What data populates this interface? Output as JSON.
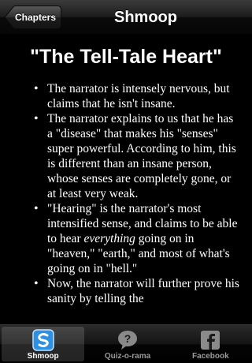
{
  "navbar": {
    "back_label": "Chapters",
    "title": "Shmoop"
  },
  "content": {
    "heading": "\"The Tell-Tale Heart\"",
    "bullets": [
      {
        "text": "The narrator is intensely nervous, but claims that he isn't insane."
      },
      {
        "text": "The narrator explains to us that he has a \"disease\" that makes his \"senses\" super powerful. According to him, this is different than an insane person, whose senses are completely gone, or at least very weak."
      },
      {
        "before": "\"Hearing\" is the narrator's most intensified sense, and claims to be able to hear ",
        "emph": "everything",
        "after": " going on in \"heaven,\" \"earth,\" and most of what's going on in \"hell.\""
      },
      {
        "text": "Now, the narrator will further prove his sanity by telling the"
      }
    ]
  },
  "tabbar": {
    "tabs": [
      {
        "label": "Shmoop",
        "icon": "shmoop-logo-icon",
        "selected": true
      },
      {
        "label": "Quiz-o-rama",
        "icon": "question-bubble-icon",
        "selected": false
      },
      {
        "label": "Facebook",
        "icon": "facebook-icon",
        "selected": false
      }
    ]
  },
  "colors": {
    "background": "#000000",
    "text": "#ffffff",
    "tab_label_inactive": "#9a9a9a",
    "shmoop_icon_blue": "#2f8fe0"
  }
}
